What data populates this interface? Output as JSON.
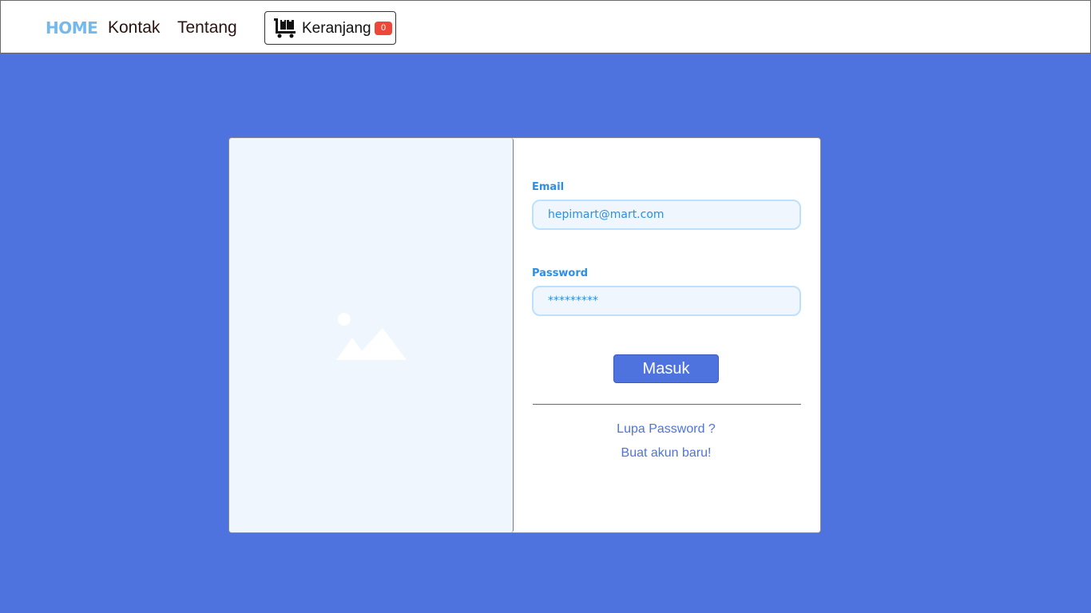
{
  "nav": {
    "home_label": "HOME",
    "links": [
      {
        "label": "Kontak"
      },
      {
        "label": "Tentang"
      }
    ],
    "cart": {
      "label": "Keranjang",
      "count": "0",
      "icon": "cart-icon"
    }
  },
  "login": {
    "image_icon": "image-placeholder-icon",
    "email": {
      "label": "Email",
      "value": "hepimart@mart.com"
    },
    "password": {
      "label": "Password",
      "value": "*********"
    },
    "submit_label": "Masuk",
    "forgot_label": "Lupa Password ?",
    "register_label": "Buat akun baru!"
  },
  "colors": {
    "background": "#4e73df",
    "home_link": "#74b9ee",
    "accent_blue": "#2a8fe6",
    "badge": "#ee4638",
    "image_pane": "#f0f6fd"
  }
}
